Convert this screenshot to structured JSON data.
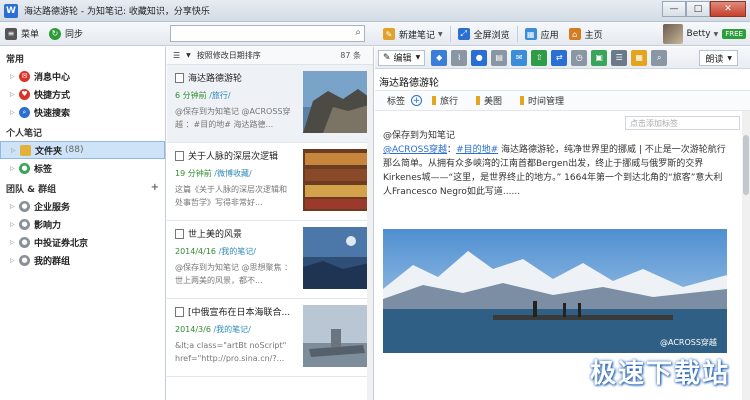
{
  "window": {
    "logo": "W",
    "title": "海达路德游轮 - 为知笔记: 收藏知识，分享快乐",
    "controls": {
      "minimize": "—",
      "maximize": "□",
      "close": "✕"
    }
  },
  "toolbar": {
    "menu_label": "菜单",
    "sync_label": "同步",
    "search_placeholder": "",
    "new_note_label": "新建笔记",
    "browse_label": "全屏浏览",
    "apps_label": "应用",
    "home_label": "主页",
    "user_name": "Betty",
    "free_badge": "FREE"
  },
  "sidebar": {
    "section_common": "常用",
    "common_items": [
      {
        "label": "消息中心",
        "icon": "message-icon",
        "color": "#d9342b"
      },
      {
        "label": "快捷方式",
        "icon": "shortcut-icon",
        "color": "#d9342b"
      },
      {
        "label": "快速搜索",
        "icon": "search-icon",
        "color": "#2a6fd1"
      }
    ],
    "section_personal": "个人笔记",
    "folder_label": "文件夹",
    "folder_count": "(88)",
    "tags_label": "标签",
    "section_team": "团队 & 群组",
    "team_plus": "+",
    "team_items": [
      {
        "label": "企业服务"
      },
      {
        "label": "影响力"
      },
      {
        "label": "中投证券北京"
      },
      {
        "label": "我的群组"
      }
    ]
  },
  "list": {
    "sort_label": "按照修改日期排序",
    "count_label": "87 条",
    "notes": [
      {
        "title": "海达路德游轮",
        "time": "6 分钟前",
        "path": "/旅行/",
        "snippet": "@保存到为知笔记 @ACROSS穿越 ：#目的地# 海达路德..."
      },
      {
        "title": "关于人脉的深层次逻辑",
        "time": "19 分钟前",
        "path": "/微博收藏/",
        "snippet": "这篇《关于人脉的深层次逻辑和处事哲学》写得非常好..."
      },
      {
        "title": "世上美的风景",
        "time": "2014/4/16",
        "path": "/我的笔记/",
        "snippet": "@保存到为知笔记 @思想聚焦 ：世上两美的风景，都不..."
      },
      {
        "title": "[中俄宣布在日本海联合...",
        "time": "2014/3/6",
        "path": "/我的笔记/",
        "snippet": "&lt;a class=\"artBt noScript\" href=\"http://pro.sina.cn/?..."
      }
    ]
  },
  "editor": {
    "edit_label": "编辑",
    "read_label": "朗读",
    "title": "海达路德游轮",
    "tags_label": "标签",
    "tags": [
      "旅行",
      "美图",
      "时间管理"
    ],
    "tag_placeholder": "点击添加标签",
    "content_line1": "@保存到为知笔记",
    "content_mention": "@ACROSS穿越",
    "content_sep": "：",
    "content_topic": "#目的地#",
    "content_text": " 海达路德游轮，纯净世界里的挪威 | 不止是一次游轮航行那么简单。从拥有众多峡湾的江南首都Bergen出发，终止于挪威与俄罗斯的交界Kirkenes城——“这里，是世界终止的地方。” 1664年第一个到达北角的“旅客”意大利人Francesco Negro如此写道......",
    "photo_credit": "@ACROSS穿越"
  },
  "watermark": "极速下载站"
}
